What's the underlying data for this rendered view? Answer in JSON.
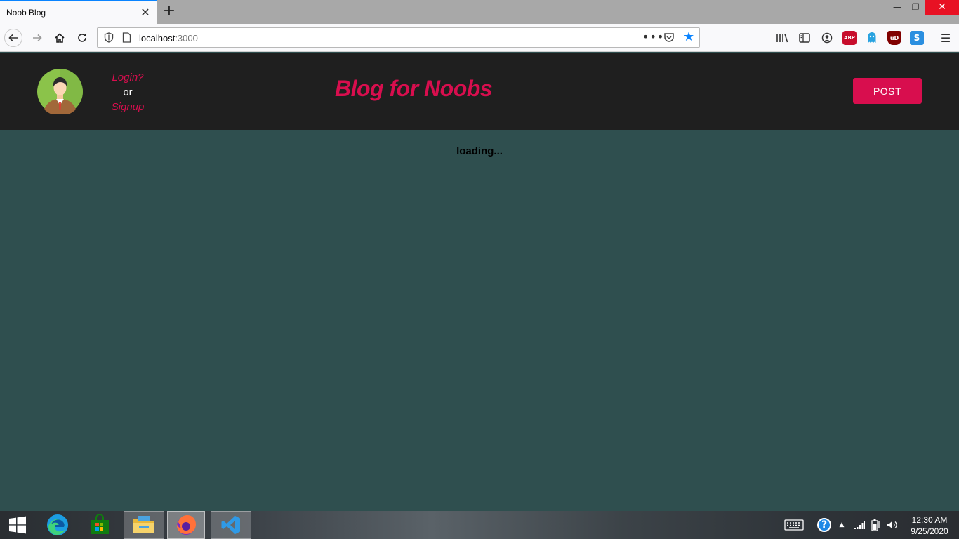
{
  "browser": {
    "tab_title": "Noob Blog",
    "url_host": "localhost",
    "url_port": ":3000",
    "icons": [
      "back-icon",
      "forward-icon",
      "home-icon",
      "reload-icon",
      "shield-icon",
      "page-icon",
      "more-icon",
      "pocket-icon",
      "bookmark-star-icon",
      "library-icon",
      "sidebar-icon",
      "account-icon",
      "adblock-plus-icon",
      "ghostery-icon",
      "ublock-icon",
      "extension-s-icon",
      "menu-icon"
    ],
    "ext_labels": {
      "abp": "ABP",
      "ublock": "uD",
      "s": "S"
    }
  },
  "header": {
    "login": "Login?",
    "or": "or",
    "signup": "Signup",
    "title": "Blog for Noobs",
    "post_button": "POST"
  },
  "main": {
    "status": "loading..."
  },
  "taskbar": {
    "apps": [
      "start-icon",
      "edge-icon",
      "store-icon",
      "file-explorer-icon",
      "firefox-icon",
      "vscode-icon"
    ],
    "time": "12:30 AM",
    "date": "9/25/2020"
  },
  "colors": {
    "accent": "#d80e4e",
    "header_bg": "#1f1f1f",
    "page_bg": "#2f4f4f",
    "browser_accent": "#0a84ff"
  }
}
